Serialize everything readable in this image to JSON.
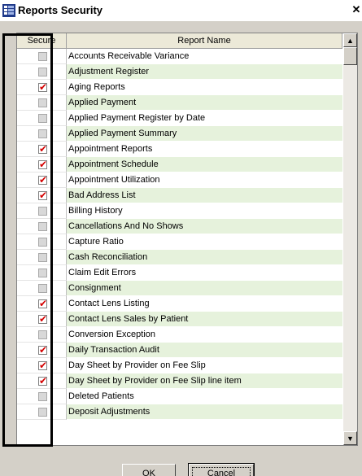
{
  "window": {
    "title": "Reports Security",
    "close_label": "✕"
  },
  "grid": {
    "columns": {
      "secure": "Secure",
      "name": "Report Name"
    },
    "rows": [
      {
        "name": "Accounts Receivable Variance",
        "secure": false
      },
      {
        "name": "Adjustment Register",
        "secure": false
      },
      {
        "name": "Aging Reports",
        "secure": true
      },
      {
        "name": "Applied Payment",
        "secure": false
      },
      {
        "name": "Applied Payment Register by Date",
        "secure": false
      },
      {
        "name": "Applied Payment Summary",
        "secure": false
      },
      {
        "name": "Appointment Reports",
        "secure": true
      },
      {
        "name": "Appointment Schedule",
        "secure": true
      },
      {
        "name": "Appointment Utilization",
        "secure": true
      },
      {
        "name": "Bad Address List",
        "secure": true
      },
      {
        "name": "Billing History",
        "secure": false
      },
      {
        "name": "Cancellations And No Shows",
        "secure": false
      },
      {
        "name": "Capture Ratio",
        "secure": false
      },
      {
        "name": "Cash Reconciliation",
        "secure": false
      },
      {
        "name": "Claim Edit Errors",
        "secure": false
      },
      {
        "name": "Consignment",
        "secure": false
      },
      {
        "name": "Contact Lens Listing",
        "secure": true
      },
      {
        "name": "Contact Lens Sales by Patient",
        "secure": true
      },
      {
        "name": "Conversion Exception",
        "secure": false
      },
      {
        "name": "Daily Transaction Audit",
        "secure": true
      },
      {
        "name": "Day Sheet by Provider on Fee Slip",
        "secure": true
      },
      {
        "name": "Day Sheet by Provider on Fee Slip line item",
        "secure": true
      },
      {
        "name": "Deleted Patients",
        "secure": false
      },
      {
        "name": "Deposit Adjustments",
        "secure": false
      }
    ]
  },
  "buttons": {
    "ok": "OK",
    "cancel": "Cancel"
  },
  "colors": {
    "check": "#d40000",
    "alt_row": "#e6f2dc",
    "dialog_bg": "#d4d0c8"
  }
}
